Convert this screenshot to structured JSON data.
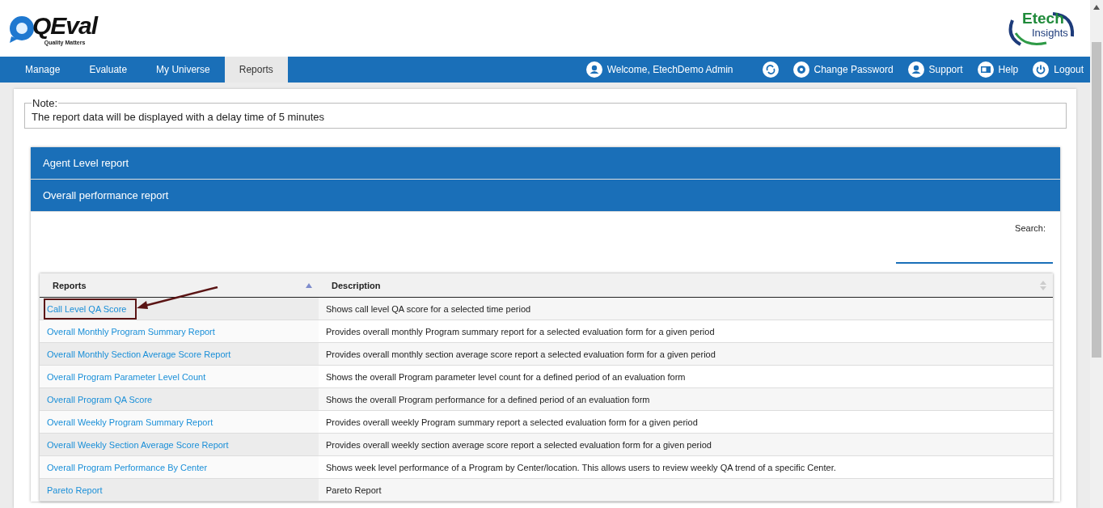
{
  "header": {
    "logo_tagline": "Quality Matters",
    "logo_text": "QEval",
    "partner_logo": {
      "line1": "Etech",
      "line2": "Insights"
    }
  },
  "nav": {
    "tabs": [
      {
        "label": "Manage",
        "selected": false
      },
      {
        "label": "Evaluate",
        "selected": false
      },
      {
        "label": "My Universe",
        "selected": false
      },
      {
        "label": "Reports",
        "selected": true
      }
    ],
    "user_links": [
      {
        "label": "Welcome, EtechDemo Admin",
        "kind": "user"
      },
      {
        "kind": "refresh"
      },
      {
        "label": "Change Password",
        "kind": "settings"
      },
      {
        "label": "Support",
        "kind": "support"
      },
      {
        "label": "Help",
        "kind": "help"
      },
      {
        "label": "Logout",
        "kind": "logout"
      }
    ]
  },
  "note": {
    "legend": "Note:",
    "text": "The report data will be displayed with a delay time of 5 minutes"
  },
  "accordion": [
    {
      "title": "Agent Level report"
    },
    {
      "title": "Overall performance report"
    }
  ],
  "search": {
    "label": "Search:"
  },
  "table": {
    "columns": [
      {
        "label": "Reports",
        "sorted": true
      },
      {
        "label": "Description",
        "sorted": false
      }
    ],
    "rows": [
      {
        "report": "Call Level QA Score",
        "description": "Shows call level QA score for a selected time period",
        "highlighted": true
      },
      {
        "report": "Overall Monthly Program Summary Report",
        "description": "Provides overall monthly Program summary report for a selected evaluation form for a given period",
        "highlighted": false
      },
      {
        "report": "Overall Monthly Section Average Score Report",
        "description": "Provides overall monthly section average score report a selected evaluation form for a given period",
        "highlighted": false
      },
      {
        "report": "Overall Program Parameter Level Count",
        "description": "Shows the overall Program parameter level count for a defined period of an evaluation form",
        "highlighted": false
      },
      {
        "report": "Overall Program QA Score",
        "description": "Shows the overall Program performance for a defined period of an evaluation form",
        "highlighted": false
      },
      {
        "report": "Overall Weekly Program Summary Report",
        "description": "Provides overall weekly Program summary report a selected evaluation form for a given period",
        "highlighted": false
      },
      {
        "report": "Overall Weekly Section Average Score Report",
        "description": "Provides overall weekly section average score report a selected evaluation form for a given period",
        "highlighted": false
      },
      {
        "report": "Overall Program Performance By Center",
        "description": "Shows week level performance of a Program by Center/location. This allows users to review weekly QA trend of a specific Center.",
        "highlighted": false
      },
      {
        "report": "Pareto Report",
        "description": "Pareto Report",
        "highlighted": false
      }
    ]
  }
}
